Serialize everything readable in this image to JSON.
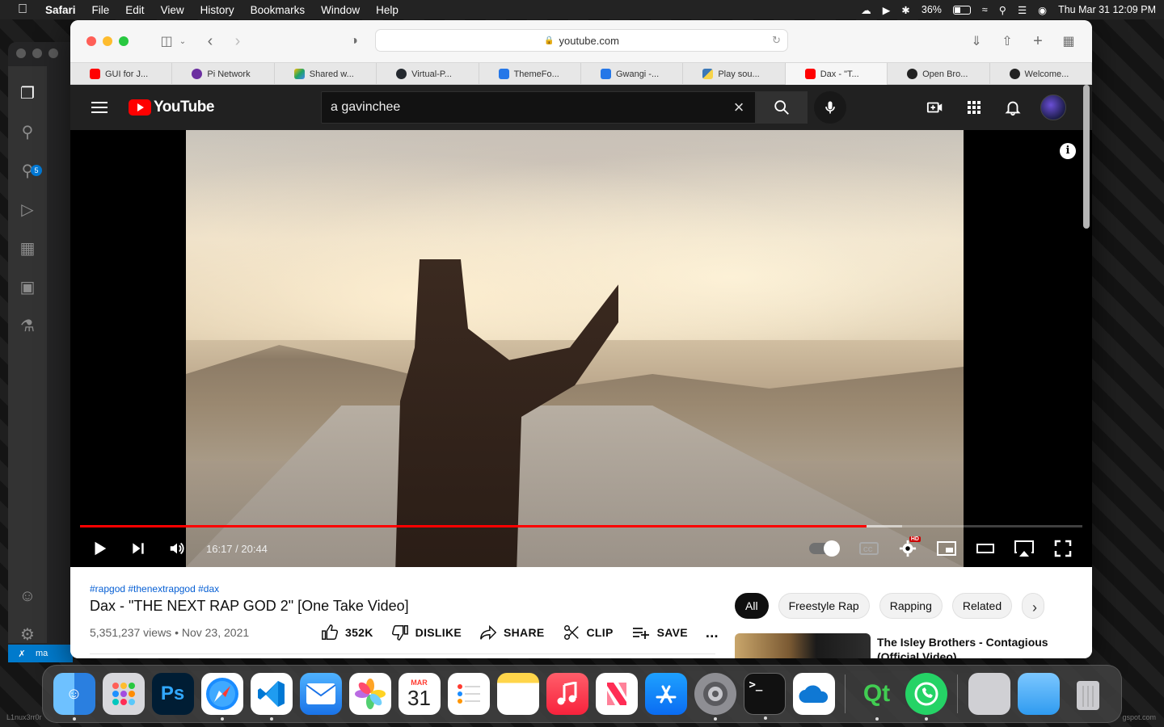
{
  "menubar": {
    "app": "Safari",
    "items": [
      "File",
      "Edit",
      "View",
      "History",
      "Bookmarks",
      "Window",
      "Help"
    ],
    "battery": "36%",
    "clock": "Thu Mar 31  12:09 PM"
  },
  "safari": {
    "url": "youtube.com",
    "tabs": [
      {
        "label": "GUI for J...",
        "favicon_color": "#ff0000"
      },
      {
        "label": "Pi Network",
        "favicon_color": "#6b2fa0"
      },
      {
        "label": "Shared w...",
        "favicon_color": "#1fa463"
      },
      {
        "label": "Virtual-P...",
        "favicon_color": "#24292f"
      },
      {
        "label": "ThemeFo...",
        "favicon_color": "#2577e8"
      },
      {
        "label": "Gwangi -...",
        "favicon_color": "#2577e8"
      },
      {
        "label": "Play sou...",
        "favicon_color": "#3b78b8"
      },
      {
        "label": "Dax - \"T...",
        "favicon_color": "#ff0000"
      },
      {
        "label": "Open Bro...",
        "favicon_color": "#222222"
      },
      {
        "label": "Welcome...",
        "favicon_color": "#222222"
      }
    ]
  },
  "youtube": {
    "logo_text": "YouTube",
    "search_query": "a gavinchee",
    "player": {
      "time": "16:17 / 20:44",
      "progress_fraction": 0.785,
      "buffered_fraction": 0.82,
      "hd_badge": "HD"
    },
    "video": {
      "tags": "#rapgod #thenextrapgod #dax",
      "title": "Dax - \"THE NEXT RAP GOD 2\" [One Take Video]",
      "meta": "5,351,237 views • Nov 23, 2021",
      "likes": "352K",
      "dislike": "DISLIKE",
      "share": "SHARE",
      "clip": "CLIP",
      "save": "SAVE",
      "more": "..."
    },
    "chips": [
      "All",
      "Freestyle Rap",
      "Rapping",
      "Related"
    ],
    "recommendation_title": "The Isley Brothers - Contagious (Official Video)"
  },
  "vscode": {
    "badge": "5",
    "status": "ma"
  },
  "dock": {
    "calendar_month": "MAR",
    "calendar_day": "31",
    "ps_label": "Ps"
  },
  "watermarks": {
    "left": "L1nux3rr0r",
    "right": "gspot.com"
  }
}
